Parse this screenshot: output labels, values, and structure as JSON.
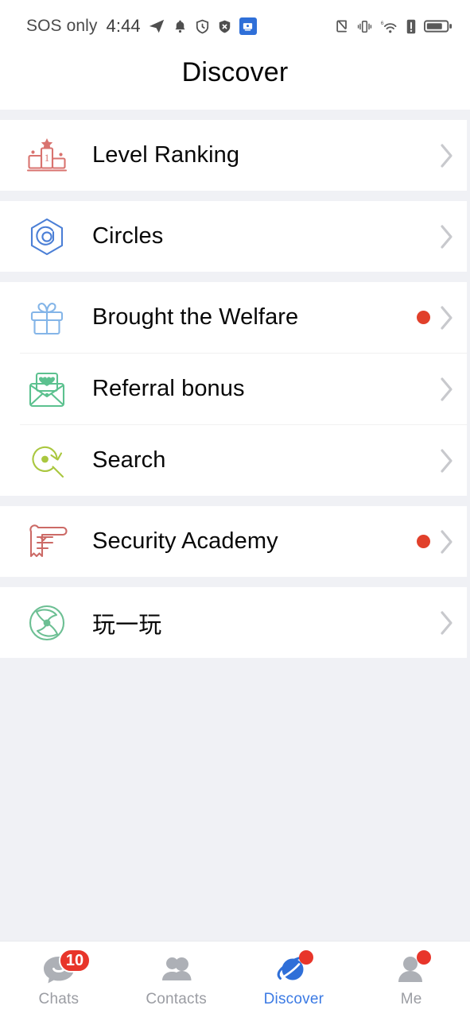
{
  "statusbar": {
    "carrier": "SOS only",
    "time": "4:44",
    "left_icons": [
      "telegram-icon",
      "bell-icon",
      "shield-clock-icon",
      "shield-x-icon",
      "app-icon"
    ],
    "right_icons": [
      "nfc-icon",
      "vibrate-icon",
      "wifi-6-icon",
      "alert-icon",
      "battery-icon"
    ]
  },
  "header": {
    "title": "Discover"
  },
  "colors": {
    "page_bg": "#f0f1f5",
    "card_bg": "#ffffff",
    "text": "#080808",
    "accent": "#3b7ae4",
    "badge_red": "#e8352a",
    "dot_red": "#e1402b",
    "chevron": "#c8c9cd"
  },
  "groups": [
    {
      "items": [
        {
          "label": "Level Ranking",
          "icon": "podium-rank-icon",
          "icon_color": "#d9736f",
          "badge": false,
          "chevron": true
        }
      ]
    },
    {
      "items": [
        {
          "label": "Circles",
          "icon": "hexagon-camera-icon",
          "icon_color": "#4b7fd6",
          "badge": false,
          "chevron": true
        }
      ]
    },
    {
      "items": [
        {
          "label": "Brought the Welfare",
          "icon": "gift-box-icon",
          "icon_color": "#84b5e8",
          "badge": true,
          "chevron": true
        },
        {
          "label": "Referral bonus",
          "icon": "envelope-heart-icon",
          "icon_color": "#5cc18f",
          "badge": false,
          "chevron": true
        },
        {
          "label": "Search",
          "icon": "search-refresh-icon",
          "icon_color": "#aac73f",
          "badge": false,
          "chevron": true
        }
      ]
    },
    {
      "items": [
        {
          "label": "Security Academy",
          "icon": "scroll-document-icon",
          "icon_color": "#cc6a66",
          "badge": true,
          "chevron": true
        }
      ]
    },
    {
      "items": [
        {
          "label": "玩一玩",
          "icon": "pinwheel-game-icon",
          "icon_color": "#6cbf93",
          "badge": false,
          "chevron": true
        }
      ]
    }
  ],
  "tabbar": {
    "tabs": [
      {
        "label": "Chats",
        "icon": "chat-bubble-icon",
        "active": false,
        "badge_count": "10",
        "badge_dot": false
      },
      {
        "label": "Contacts",
        "icon": "contacts-people-icon",
        "active": false,
        "badge_count": "",
        "badge_dot": false
      },
      {
        "label": "Discover",
        "icon": "planet-discover-icon",
        "active": true,
        "badge_count": "",
        "badge_dot": true
      },
      {
        "label": "Me",
        "icon": "person-avatar-icon",
        "active": false,
        "badge_count": "",
        "badge_dot": true
      }
    ]
  }
}
